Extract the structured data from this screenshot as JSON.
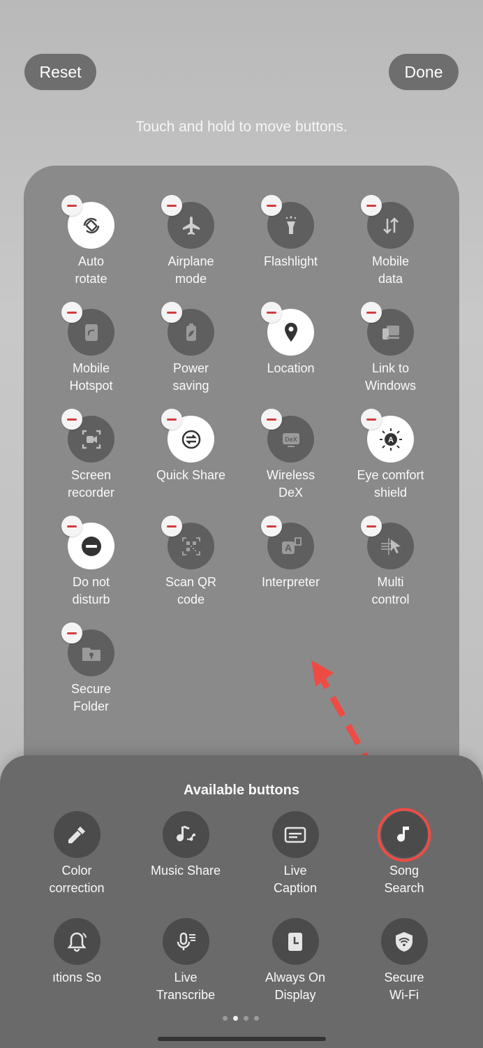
{
  "header": {
    "reset_label": "Reset",
    "done_label": "Done",
    "hint": "Touch and hold to move buttons."
  },
  "active_tiles": [
    {
      "label": "Auto\nrotate",
      "icon": "auto-rotate-icon",
      "on": true
    },
    {
      "label": "Airplane\nmode",
      "icon": "airplane-icon",
      "on": false
    },
    {
      "label": "Flashlight",
      "icon": "flashlight-icon",
      "on": false
    },
    {
      "label": "Mobile\ndata",
      "icon": "mobile-data-icon",
      "on": false
    },
    {
      "label": "Mobile\nHotspot",
      "icon": "hotspot-icon",
      "on": false
    },
    {
      "label": "Power\nsaving",
      "icon": "battery-leaf-icon",
      "on": false
    },
    {
      "label": "Location",
      "icon": "location-pin-icon",
      "on": true
    },
    {
      "label": "Link to\nWindows",
      "icon": "link-windows-icon",
      "on": false
    },
    {
      "label": "Screen\nrecorder",
      "icon": "screen-recorder-icon",
      "on": false
    },
    {
      "label": "Quick Share",
      "icon": "quick-share-icon",
      "on": true
    },
    {
      "label": "Wireless\nDeX",
      "icon": "dex-icon",
      "on": false
    },
    {
      "label": "Eye comfort\nshield",
      "icon": "eye-comfort-icon",
      "on": true
    },
    {
      "label": "Do not\ndisturb",
      "icon": "do-not-disturb-icon",
      "on": true
    },
    {
      "label": "Scan QR\ncode",
      "icon": "qr-code-icon",
      "on": false
    },
    {
      "label": "Interpreter",
      "icon": "interpreter-icon",
      "on": false
    },
    {
      "label": "Multi\ncontrol",
      "icon": "multi-control-icon",
      "on": false
    },
    {
      "label": "Secure\nFolder",
      "icon": "secure-folder-icon",
      "on": false
    }
  ],
  "sheet": {
    "title": "Available buttons",
    "items": [
      {
        "label": "Color\ncorrection",
        "icon": "eyedropper-icon",
        "highlighted": false
      },
      {
        "label": "Music Share",
        "icon": "music-share-icon",
        "highlighted": false
      },
      {
        "label": "Live\nCaption",
        "icon": "caption-icon",
        "highlighted": false
      },
      {
        "label": "Song\nSearch",
        "icon": "music-note-icon",
        "highlighted": true
      },
      {
        "label": "ıtions     So",
        "icon": "notification-bell-icon",
        "highlighted": false
      },
      {
        "label": "Live\nTranscribe",
        "icon": "transcribe-mic-icon",
        "highlighted": false
      },
      {
        "label": "Always On\nDisplay",
        "icon": "clock-icon",
        "highlighted": false
      },
      {
        "label": "Secure\nWi-Fi",
        "icon": "secure-wifi-icon",
        "highlighted": false
      }
    ],
    "page_dots": 4,
    "active_page": 2
  },
  "colors": {
    "highlight": "#ef4b45",
    "remove_minus": "#d23c3c"
  }
}
